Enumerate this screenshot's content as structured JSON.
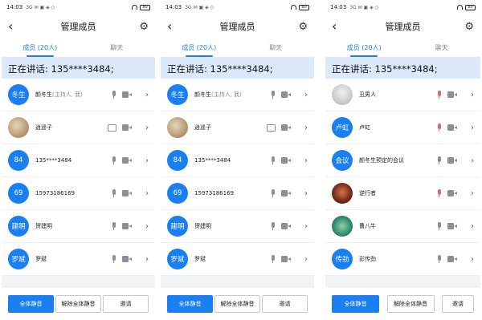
{
  "panels": [
    {
      "status_time": "14:03",
      "status_icons": "3G ✉ ▣ ◈ ◇",
      "battery": "80",
      "title": "管理成员",
      "tabs": [
        "成员 (20人)",
        "聊天"
      ],
      "speaking": "正在讲话: 135****3484;",
      "members": [
        {
          "avatar": "冬生",
          "name": "颜冬生",
          "role": "(主持人, 我)",
          "avatar_style": "text",
          "share": false,
          "mic_muted": false
        },
        {
          "avatar": "",
          "name": "逍遥子",
          "role": "",
          "avatar_style": "photo",
          "share": true,
          "mic_muted": false
        },
        {
          "avatar": "84",
          "name": "135****3484",
          "role": "",
          "avatar_style": "text",
          "share": false,
          "mic_muted": false
        },
        {
          "avatar": "69",
          "name": "15973186169",
          "role": "",
          "avatar_style": "text",
          "share": false,
          "mic_muted": false
        },
        {
          "avatar": "建明",
          "name": "贺建明",
          "role": "",
          "avatar_style": "text",
          "share": false,
          "mic_muted": false
        },
        {
          "avatar": "罗斌",
          "name": "罗斌",
          "role": "",
          "avatar_style": "text",
          "share": false,
          "mic_muted": false
        }
      ],
      "buttons": [
        "全体静音",
        "解除全体静音",
        "邀请"
      ]
    },
    {
      "status_time": "14:03",
      "status_icons": "3G ✉ ▣ ◈ ◇",
      "battery": "80",
      "title": "管理成员",
      "tabs": [
        "成员 (20人)",
        "聊天"
      ],
      "speaking": "正在讲话: 135****3484;",
      "members": [
        {
          "avatar": "冬生",
          "name": "颜冬生",
          "role": "(主持人, 我)",
          "avatar_style": "text",
          "share": false,
          "mic_muted": false
        },
        {
          "avatar": "",
          "name": "逍遥子",
          "role": "",
          "avatar_style": "photo",
          "share": true,
          "mic_muted": false
        },
        {
          "avatar": "84",
          "name": "135****3484",
          "role": "",
          "avatar_style": "text",
          "share": false,
          "mic_muted": false
        },
        {
          "avatar": "69",
          "name": "15973186169",
          "role": "",
          "avatar_style": "text",
          "share": false,
          "mic_muted": false
        },
        {
          "avatar": "建明",
          "name": "贺建明",
          "role": "",
          "avatar_style": "text",
          "share": false,
          "mic_muted": false
        },
        {
          "avatar": "罗斌",
          "name": "罗斌",
          "role": "",
          "avatar_style": "text",
          "share": false,
          "mic_muted": false
        }
      ],
      "buttons": [
        "全体静音",
        "解除全体静音",
        "邀请"
      ]
    },
    {
      "status_time": "14:03",
      "status_icons": "3G ✉ ▣ ◈ ◇",
      "battery": "80",
      "title": "管理成员",
      "tabs": [
        "成员 (20人)",
        "聊天"
      ],
      "speaking": "正在讲话: 135****3484;",
      "members": [
        {
          "avatar": "",
          "name": "丑男人",
          "role": "",
          "avatar_style": "plain",
          "share": false,
          "mic_muted": true
        },
        {
          "avatar": "卢虹",
          "name": "卢虹",
          "role": "",
          "avatar_style": "text",
          "share": false,
          "mic_muted": true
        },
        {
          "avatar": "会议",
          "name": "颜冬生预定的会议",
          "role": "",
          "avatar_style": "text",
          "share": false,
          "mic_muted": false
        },
        {
          "avatar": "",
          "name": "逆行者",
          "role": "",
          "avatar_style": "dark",
          "share": false,
          "mic_muted": true
        },
        {
          "avatar": "",
          "name": "曹八牛",
          "role": "",
          "avatar_style": "green",
          "share": false,
          "mic_muted": false
        },
        {
          "avatar": "传劲",
          "name": "彭传劲",
          "role": "",
          "avatar_style": "text",
          "share": false,
          "mic_muted": false
        }
      ],
      "buttons": [
        "全体静音",
        "解除全体静音",
        "邀请"
      ]
    }
  ],
  "icons": {
    "back": "back-arrow-icon",
    "settings": "gear-icon",
    "mic": "microphone-icon",
    "camera": "video-camera-icon",
    "share": "screen-share-icon",
    "chevron": "chevron-right-icon"
  },
  "colors": {
    "accent": "#1a7ff0",
    "speaking_bar": "#dbe9fa",
    "muted_mic": "#d96b6b"
  }
}
